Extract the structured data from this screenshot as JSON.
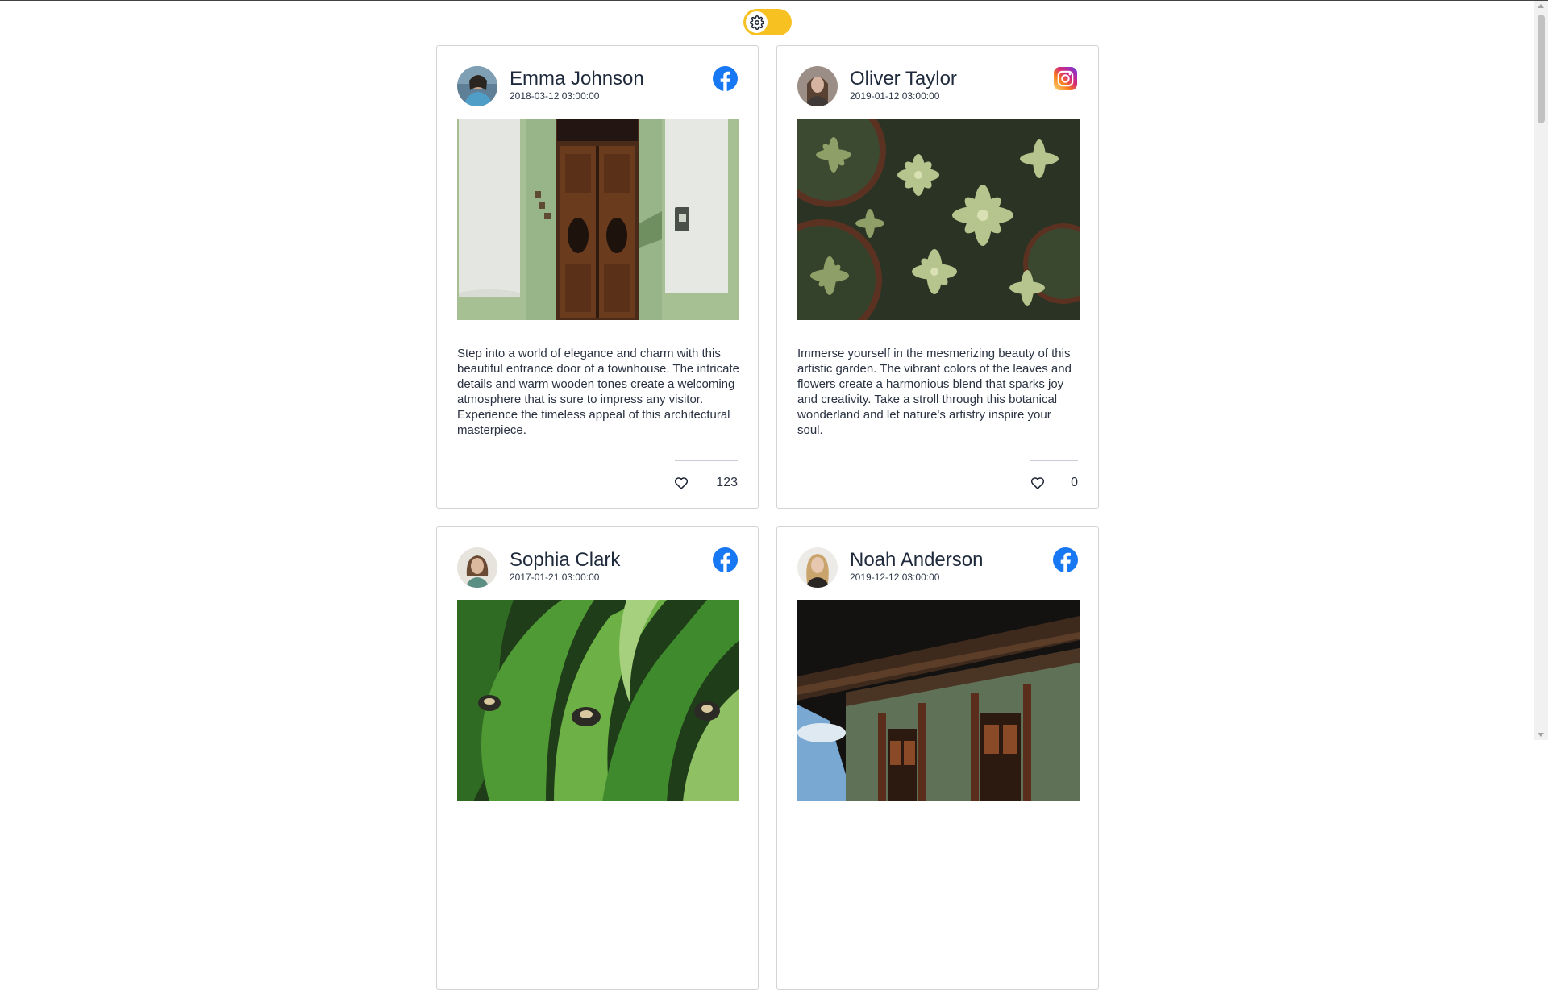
{
  "theme_toggle": {
    "icon": "gear-icon",
    "color": "#f7c122"
  },
  "brand_colors": {
    "facebook": "#1877f2",
    "heart": "#1c2333"
  },
  "posts": [
    {
      "name": "Emma Johnson",
      "date": "2018-03-12 03:00:00",
      "social": "facebook",
      "description": "Step into a world of elegance and charm with this beautiful entrance door of a townhouse. The intricate details and warm wooden tones create a welcoming atmosphere that is sure to impress any visitor. Experience the timeless appeal of this architectural masterpiece.",
      "likes": "123"
    },
    {
      "name": "Oliver Taylor",
      "date": "2019-01-12 03:00:00",
      "social": "instagram",
      "description": "Immerse yourself in the mesmerizing beauty of this artistic garden. The vibrant colors of the leaves and flowers create a harmonious blend that sparks joy and creativity. Take a stroll through this botanical wonderland and let nature's artistry inspire your soul.",
      "likes": "0"
    },
    {
      "name": "Sophia Clark",
      "date": "2017-01-21 03:00:00",
      "social": "facebook",
      "description": "",
      "likes": ""
    },
    {
      "name": "Noah Anderson",
      "date": "2019-12-12 03:00:00",
      "social": "facebook",
      "description": "",
      "likes": ""
    }
  ]
}
